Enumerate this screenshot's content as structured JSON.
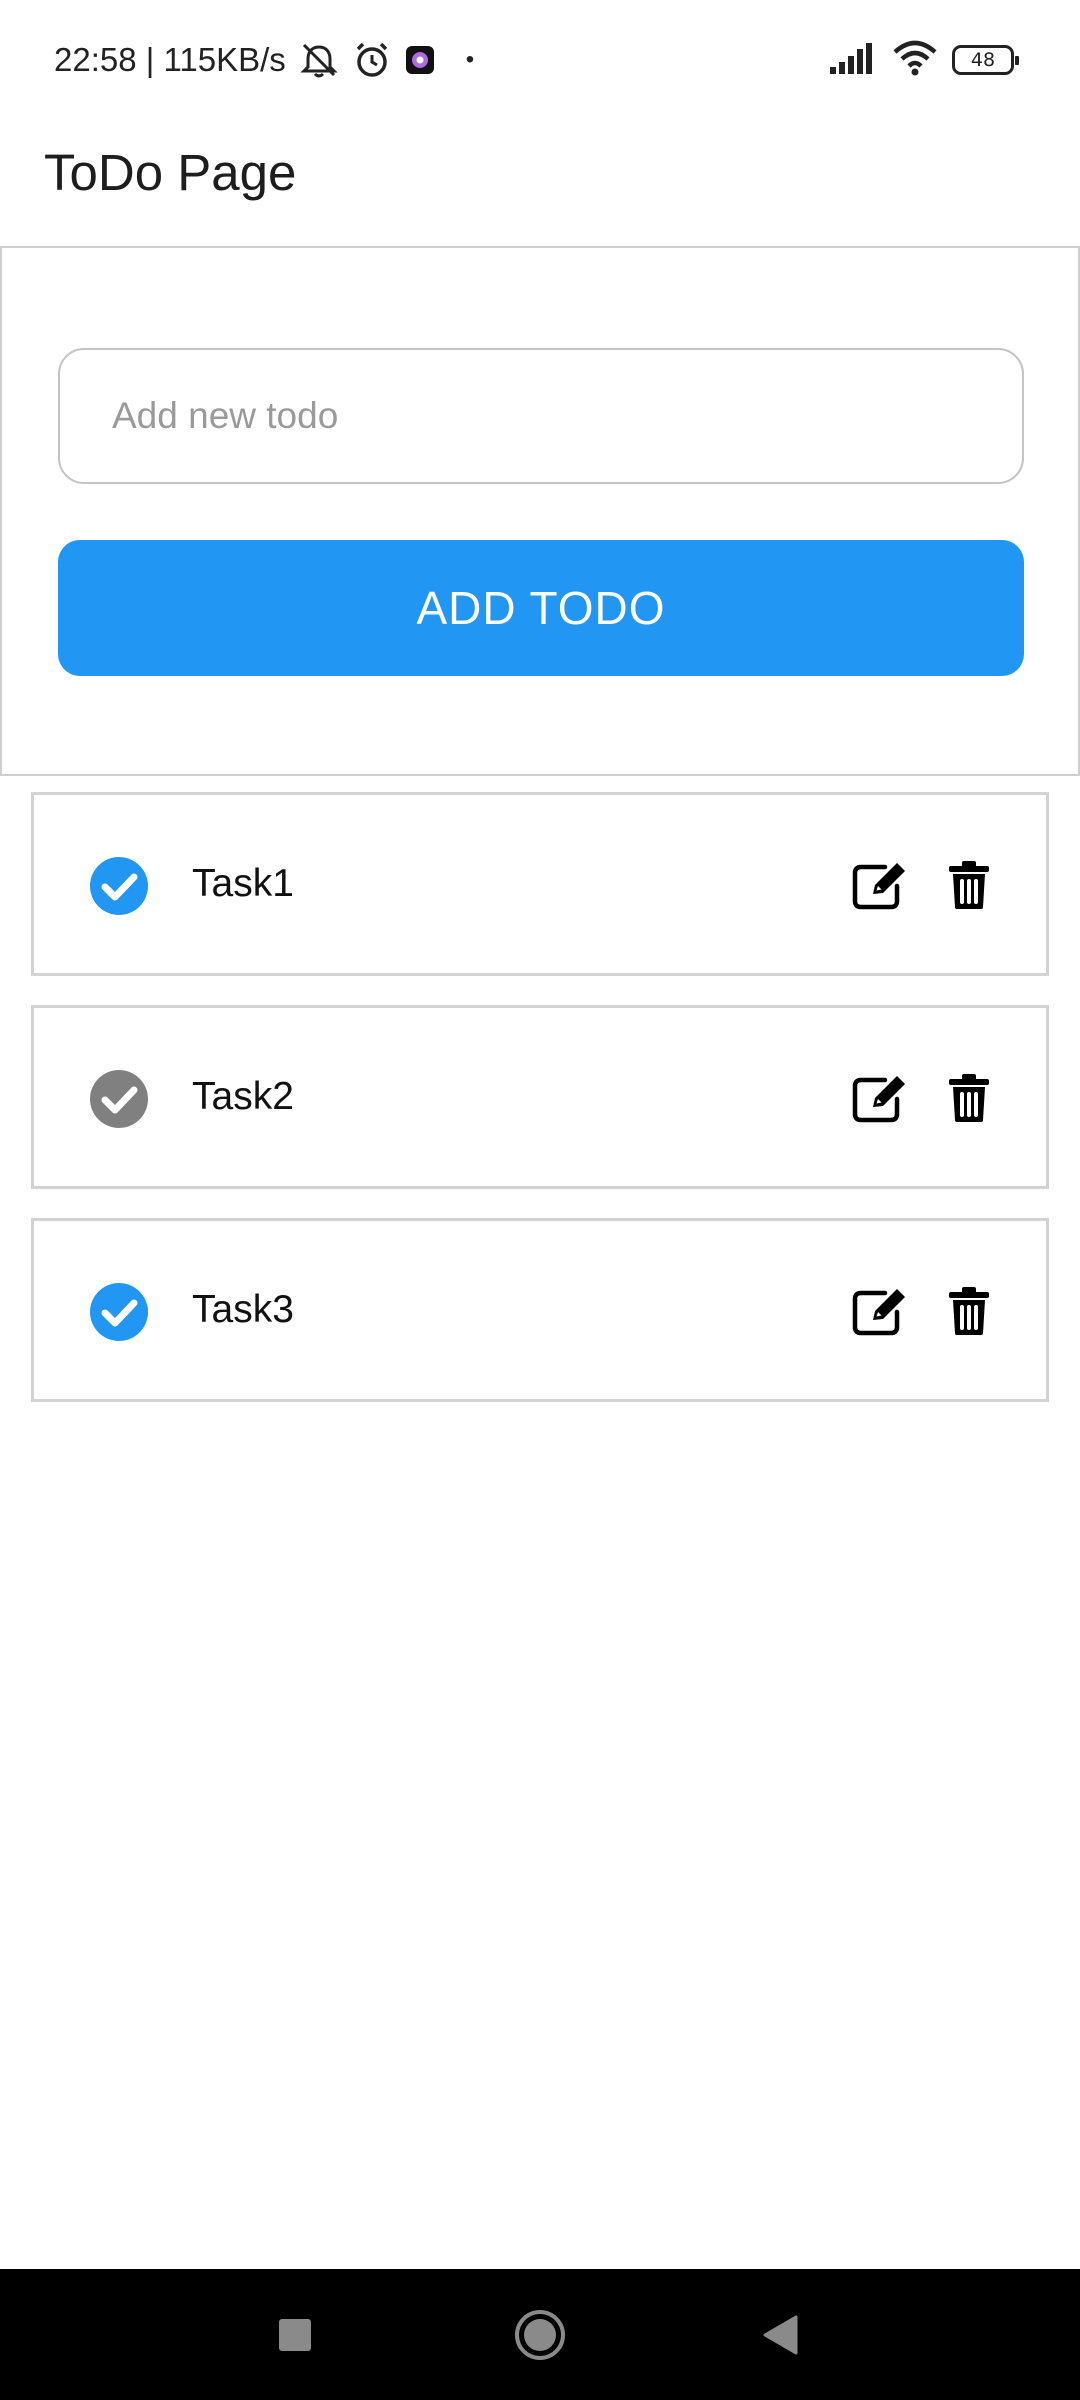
{
  "status_bar": {
    "time_speed": "22:58 | 115KB/s",
    "dot": "•",
    "battery_level": "48"
  },
  "app_bar": {
    "title": "ToDo Page"
  },
  "add_form": {
    "input_value": "",
    "input_placeholder": "Add new todo",
    "button_label": "ADD TODO"
  },
  "todos": [
    {
      "label": "Task1",
      "completed": true
    },
    {
      "label": "Task2",
      "completed": false
    },
    {
      "label": "Task3",
      "completed": true
    }
  ],
  "colors": {
    "accent": "#2196f3",
    "check_completed": "#2196f3",
    "check_incomplete": "#808080",
    "card_border": "#d3d3d3",
    "nav_bar": "#000000"
  },
  "icons": {
    "check": "check-circle-icon",
    "edit": "edit-icon",
    "delete": "trash-icon",
    "nav_recents": "square-icon",
    "nav_home": "circle-icon",
    "nav_back": "triangle-back-icon"
  }
}
